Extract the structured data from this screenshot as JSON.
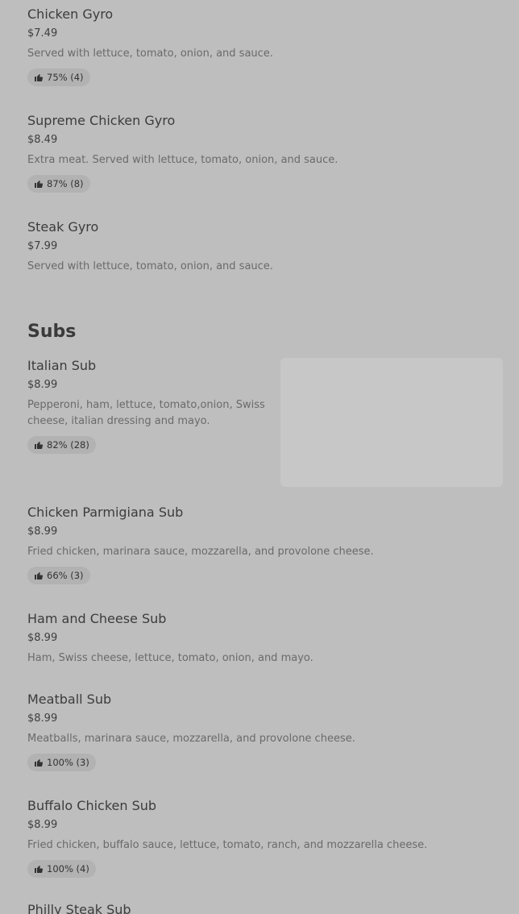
{
  "section": {
    "title": "Subs"
  },
  "items": [
    {
      "name": "Chicken Gyro",
      "price": "$7.49",
      "description": "Served with lettuce, tomato, onion, and sauce.",
      "rating": "75% (4)"
    },
    {
      "name": "Supreme Chicken Gyro",
      "price": "$8.49",
      "description": "Extra meat. Served with lettuce, tomato, onion, and sauce.",
      "rating": "87% (8)"
    },
    {
      "name": "Steak Gyro",
      "price": "$7.99",
      "description": "Served with lettuce, tomato, onion, and sauce."
    },
    {
      "name": "Italian Sub",
      "price": "$8.99",
      "description": "Pepperoni, ham, lettuce, tomato,onion, Swiss cheese, italian dressing and mayo.",
      "rating": "82% (28)"
    },
    {
      "name": "Chicken Parmigiana Sub",
      "price": "$8.99",
      "description": "Fried chicken, marinara sauce, mozzarella, and provolone cheese.",
      "rating": "66% (3)"
    },
    {
      "name": "Ham and Cheese Sub",
      "price": "$8.99",
      "description": "Ham, Swiss cheese, lettuce, tomato, onion, and mayo."
    },
    {
      "name": "Meatball Sub",
      "price": "$8.99",
      "description": "Meatballs, marinara sauce, mozzarella, and provolone cheese.",
      "rating": "100% (3)"
    },
    {
      "name": "Buffalo Chicken Sub",
      "price": "$8.99",
      "description": "Fried chicken, buffalo sauce, lettuce, tomato, ranch, and mozzarella cheese.",
      "rating": "100% (4)"
    },
    {
      "name": "Philly Steak Sub"
    }
  ],
  "icons": {
    "rating": "thumbs-up-icon"
  }
}
